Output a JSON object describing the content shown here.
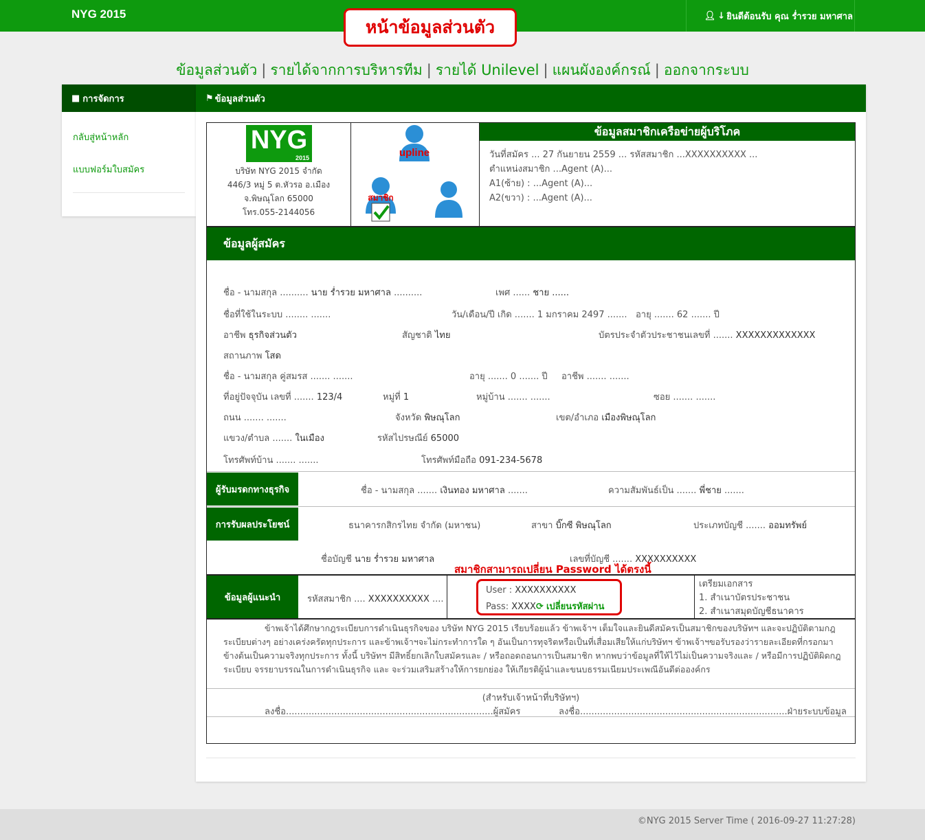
{
  "header": {
    "brand": "NYG 2015",
    "page_title": "หน้าข้อมูลส่วนตัว",
    "welcome": "ยินดีต้อนรับ คุณ ร่ำรวย มหาศาล"
  },
  "nav": {
    "items": [
      "ข้อมูลส่วนตัว",
      "รายได้จากการบริหารทีม",
      "รายได้ Unilevel",
      "แผนผังองค์กรณ์",
      "ออกจากระบบ"
    ]
  },
  "sidebar": {
    "heading": "การจัดการ",
    "items": [
      "กลับสู่หน้าหลัก",
      "แบบฟอร์มใบสมัคร"
    ]
  },
  "main": {
    "heading": "ข้อมูลส่วนตัว"
  },
  "company": {
    "logo_text": "NYG",
    "logo_year": "2015",
    "name": "บริษัท NYG 2015 จำกัด",
    "address1": "446/3 หมู่ 5 ต.หัวรอ อ.เมือง",
    "address2": "จ.พิษณุโลก 65000",
    "phone": "โทร.055-2144056"
  },
  "diagram": {
    "upline_label": "upline",
    "member_label": "สมาชิก"
  },
  "member_info": {
    "title": "ข้อมูลสมาชิกเครือข่ายผู้บริโภค",
    "line1": "วันที่สมัคร ... 27 กันยายน 2559 ... รหัสสมาชิก ...XXXXXXXXXX ...",
    "line2": "ตำแหน่งสมาชิก ...Agent (A)...",
    "line3": "A1(ซ้าย) : ...Agent (A)...",
    "line4": "A2(ขวา) : ...Agent (A)..."
  },
  "applicant": {
    "section_title": "ข้อมูลผู้สมัคร",
    "name_label": "ชื่อ - นามสกุล ..........",
    "name_value": "นาย ร่ำรวย มหาศาล",
    "name_tail": "..........",
    "sex_label": "เพศ ......",
    "sex_value": "ชาย ......",
    "username_label": "ชื่อที่ใช้ในระบบ ........ .......",
    "dob_label": "วัน/เดือน/ปี เกิด ....... 1 มกราคม 2497 .......",
    "age_label": "อายุ ....... 62 ....... ปี",
    "occupation_label": "อาชีพ",
    "occupation_value": "ธุรกิจส่วนตัว",
    "nationality_label": "สัญชาติ",
    "nationality_value": "ไทย",
    "idcard_label": "บัตรประจำตัวประชาชนเลขที่ .......",
    "idcard_value": "XXXXXXXXXXXXX",
    "status_label": "สถานภาพ",
    "status_value": "โสด",
    "spouse_label": "ชื่อ - นามสกุล คู่สมรส ....... .......",
    "spouse_age": "อายุ ....... 0 ....... ปี",
    "spouse_occ": "อาชีพ ....... .......",
    "house_no_label": "ที่อยู่ปัจจุบัน เลขที่ .......",
    "house_no_value": "123/4",
    "moo_label": "หมู่ที่",
    "moo_value": "1",
    "village_label": "หมู่บ้าน ....... .......",
    "soi_label": "ซอย ....... .......",
    "road_label": "ถนน ....... .......",
    "province_label": "จังหวัด",
    "province_value": "พิษณุโลก",
    "district_label": "เขต/อำเภอ",
    "district_value": "เมืองพิษณุโลก",
    "subdistrict_label": "แขวง/ตำบล .......",
    "subdistrict_value": "ในเมือง",
    "postcode_label": "รหัสไปรษณีย์",
    "postcode_value": "65000",
    "home_phone_label": "โทรศัพท์บ้าน ....... .......",
    "mobile_label": "โทรศัพท์มือถือ",
    "mobile_value": "091-234-5678"
  },
  "heir": {
    "label": "ผู้รับมรดกทางธุรกิจ",
    "name_label": "ชื่อ - นามสกุล .......",
    "name_value": "เงินทอง มหาศาล",
    "relation_label": "ความสัมพันธ์เป็น .......",
    "relation_value": "พี่ชาย"
  },
  "benefit": {
    "label": "การรับผลประโยชน์",
    "bank": "ธนาคารกสิกรไทย จำกัด (มหาชน)",
    "branch_label": "สาขา",
    "branch_value": "บิ๊กซี พิษณุโลก",
    "type_label": "ประเภทบัญชี .......",
    "type_value": "ออมทรัพย์",
    "acc_name_label": "ชื่อบัญชี",
    "acc_name_value": "นาย ร่ำรวย มหาศาล",
    "acc_no_label": "เลขที่บัญชี .......",
    "acc_no_value": "XXXXXXXXXX"
  },
  "note": "สมาชิกสามารถเปลี่ยน Password ได้ตรงนี้",
  "referrer": {
    "label": "ข้อมูลผู้แนะนำ",
    "code_label": "รหัสสมาชิก ....",
    "code_value": "XXXXXXXXXX",
    "user_label": "User :",
    "user_value": "XXXXXXXXXX",
    "pass_label": "Pass:",
    "pass_value": "XXXX",
    "change_pass": "เปลี่ยนรหัสผ่าน",
    "docs_title": "เตรียมเอกสาร",
    "doc1": "1. สำเนาบัตรประชาชน",
    "doc2": "2. สำเนาสมุดบัญชีธนาคาร"
  },
  "agreement": "ข้าพเจ้าได้ศึกษากฎระเบียบการดำเนินธุรกิจของ บริษัท NYG 2015 เรียบร้อยแล้ว ข้าพเจ้าฯ เต็มใจและยินดีสมัครเป็นสมาชิกของบริษัทฯ และจะปฏิบัติตามกฎระเบียบต่างๆ อย่างเคร่งครัดทุกประการ และข้าพเจ้าฯจะไม่กระทำการใด ๆ อันเป็นการทุจริตหรือเป็นที่เสื่อมเสียให้แก่บริษัทฯ ข้าพเจ้าฯขอรับรองว่ารายละเอียดที่กรอกมาข้างต้นเป็นความจริงทุกประการ ทั้งนี้ บริษัทฯ มีสิทธิ์ยกเลิกใบสมัครและ / หรือถอดถอนการเป็นสมาชิก หากพบว่าข้อมูลที่ให้ไว้ไม่เป็นความจริงและ / หรือมีการปฏิบัติผิดกฎระเบียบ จรรยาบรรณในการดำเนินธุรกิจ และ จะร่วมเสริมสร้างให้การยกย่อง ให้เกียรติผู้นำและขนบธรรมเนียมประเพณีอันดีต่อองค์กร",
  "signature": {
    "office_note": "(สำหรับเจ้าหน้าที่บริษัทฯ)",
    "sign1": "ลงชื่อ.........................................................................ผู้สมัคร",
    "sign2": "ลงชื่อ.........................................................................ฝ่ายระบบข้อมูล"
  },
  "footer": "©NYG 2015 Server Time ( 2016-09-27 11:27:28)"
}
